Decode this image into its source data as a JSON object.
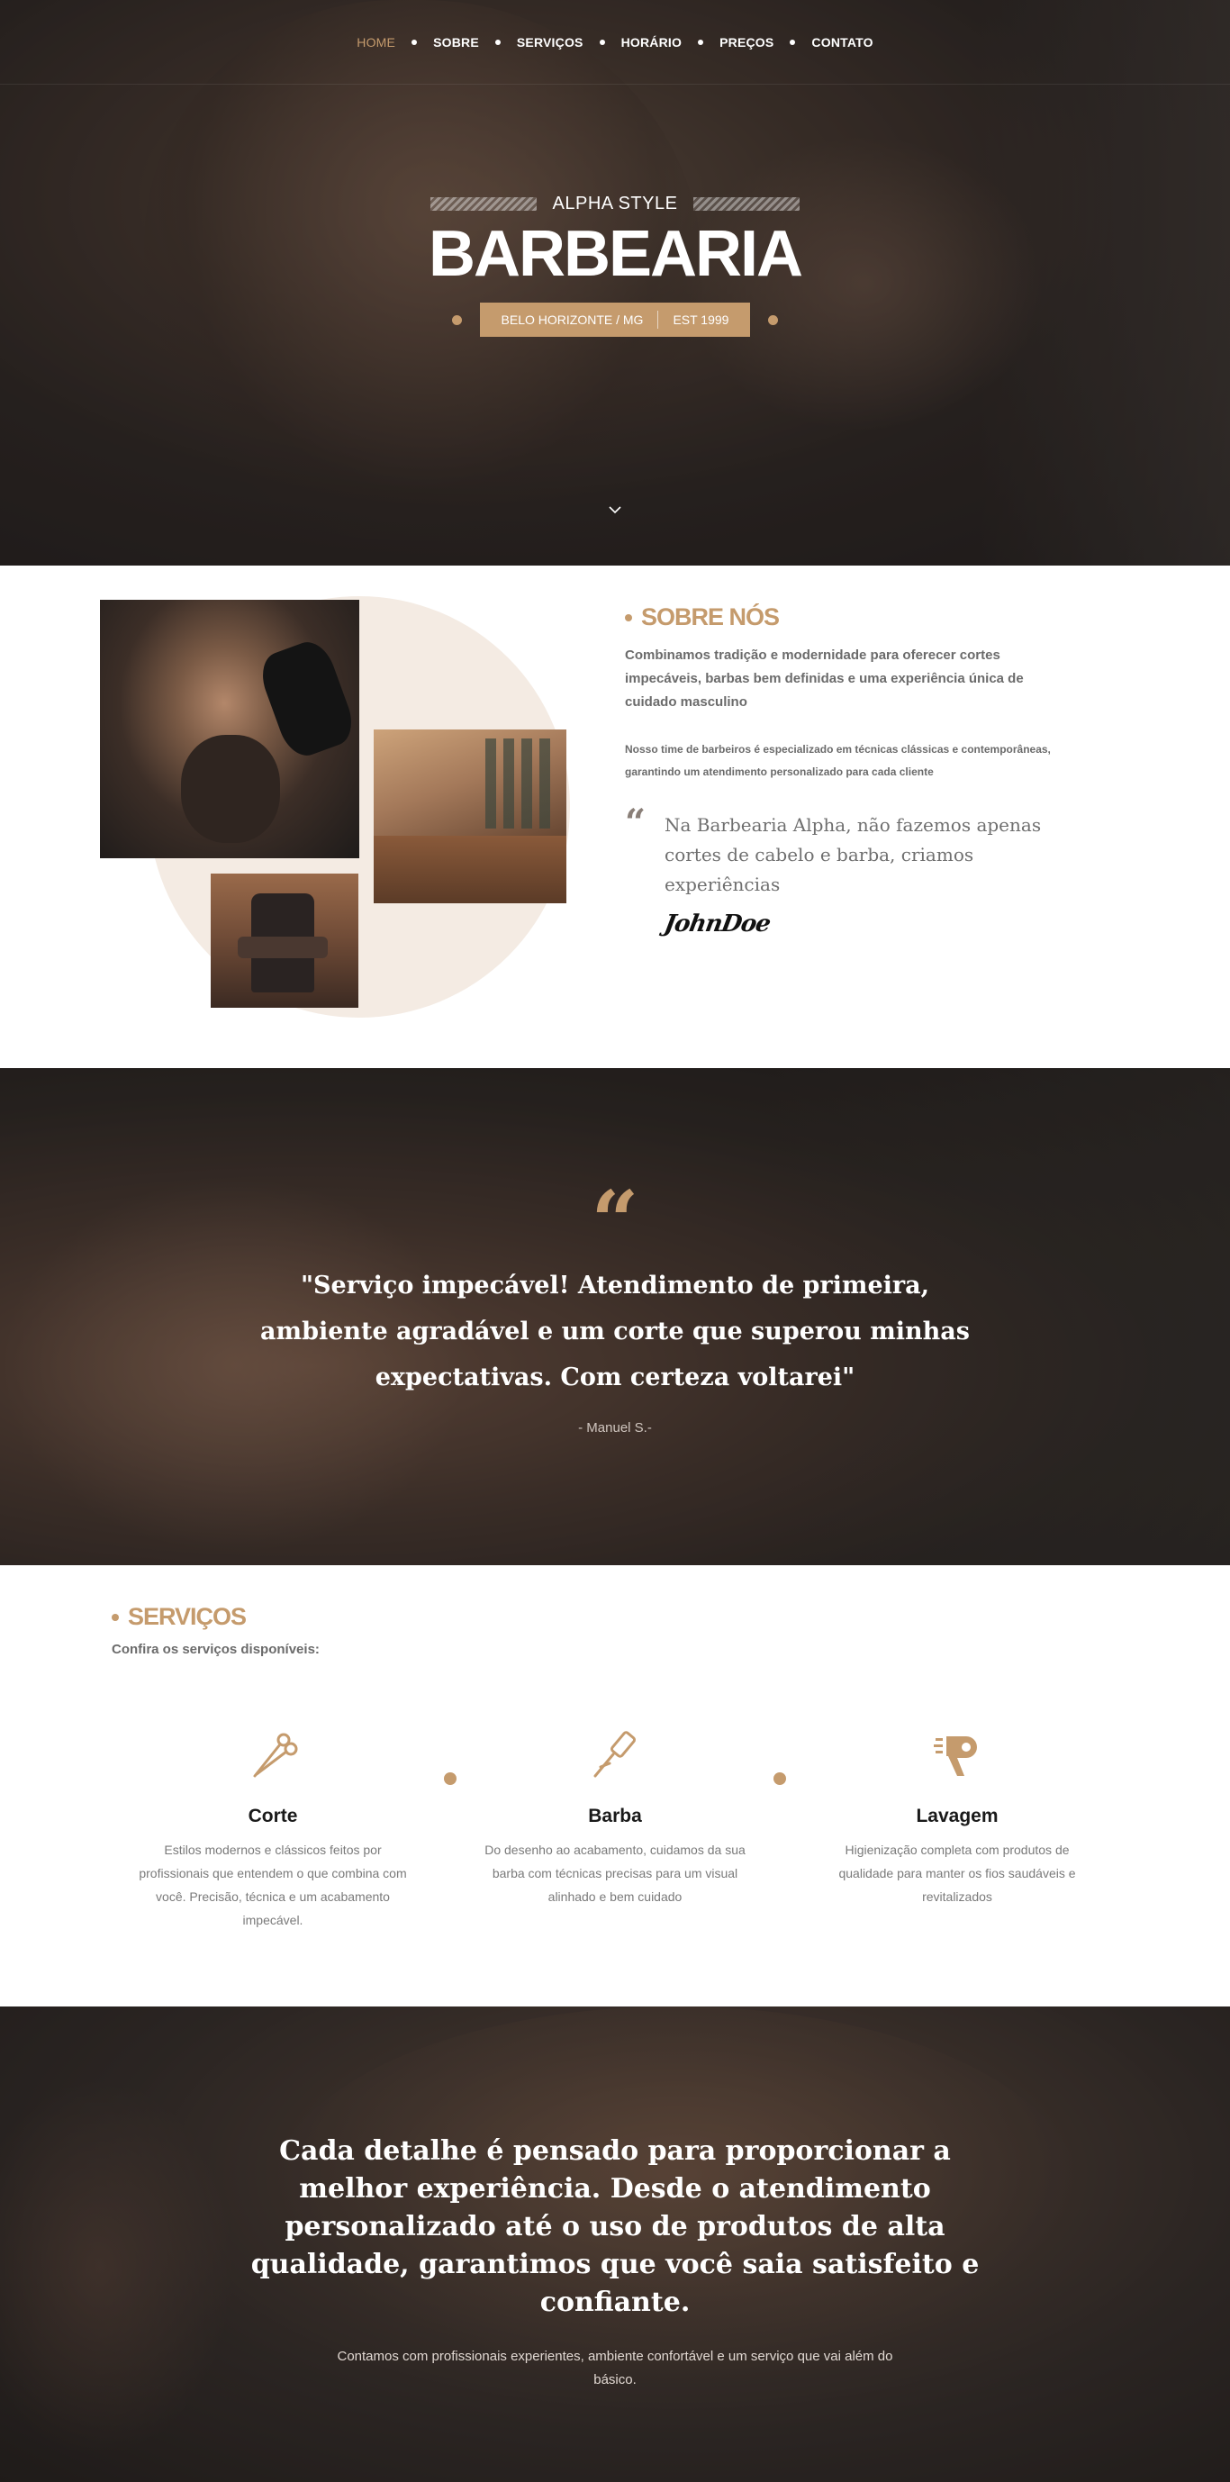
{
  "nav": {
    "items": [
      {
        "label": "HOME",
        "active": true
      },
      {
        "label": "SOBRE"
      },
      {
        "label": "SERVIÇOS"
      },
      {
        "label": "HORÁRIO"
      },
      {
        "label": "PREÇOS"
      },
      {
        "label": "CONTATO"
      }
    ]
  },
  "hero": {
    "tagline": "ALPHA STYLE",
    "title": "BARBEARIA",
    "location": "BELO HORIZONTE / MG",
    "established": "EST 1999",
    "scroll_icon": "chevron-down-icon"
  },
  "about": {
    "heading": "SOBRE NÓS",
    "lead": "Combinamos tradição e modernidade para oferecer cortes impecáveis, barbas bem definidas e uma experiência única de cuidado masculino",
    "sub": "Nosso time de barbeiros é especializado em técnicas clássicas e contemporâneas, garantindo um atendimento personalizado para cada cliente",
    "quote": "Na Barbearia Alpha, não fazemos apenas cortes de cabelo e barba, criamos experiências",
    "signature": "JohnDoe"
  },
  "testimonial": {
    "quote": "\"Serviço impecável! Atendimento de primeira, ambiente agradável e um corte que superou minhas expectativas. Com certeza voltarei\"",
    "author": "- Manuel S.-"
  },
  "services": {
    "heading": "SERVIÇOS",
    "subheading": "Confira os serviços disponíveis:",
    "items": [
      {
        "icon": "scissors-icon",
        "title": "Corte",
        "text": "Estilos modernos e clássicos feitos por profissionais que entendem o que combina com você. Precisão, técnica e um acabamento impecável."
      },
      {
        "icon": "razor-icon",
        "title": "Barba",
        "text": "Do desenho ao acabamento, cuidamos da sua barba com técnicas precisas para um visual alinhado e bem cuidado"
      },
      {
        "icon": "hair-dryer-icon",
        "title": "Lavagem",
        "text": "Higienização completa com produtos de qualidade para manter os fios saudáveis e revitalizados"
      }
    ]
  },
  "closing": {
    "title": "Cada detalhe é pensado para proporcionar a melhor experiência. Desde o atendimento personalizado até o uso de produtos de alta qualidade, garantimos que você saia satisfeito e confiante.",
    "text": "Contamos com profissionais experientes, ambiente confortável e um serviço que vai além do básico."
  },
  "colors": {
    "accent": "#c59b6d",
    "light_circle": "#f4ebe3",
    "dark_overlay": "#231f1e"
  }
}
